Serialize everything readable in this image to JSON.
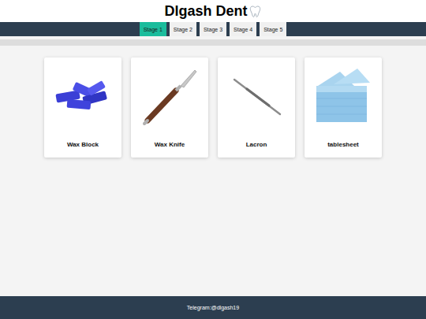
{
  "header": {
    "title": "Dlgash Dent"
  },
  "tabs": [
    {
      "label": "Stage 1",
      "selected": true
    },
    {
      "label": "Stage 2",
      "selected": false
    },
    {
      "label": "Stage 3",
      "selected": false
    },
    {
      "label": "Stage 4",
      "selected": false
    },
    {
      "label": "Stage 5",
      "selected": false
    }
  ],
  "items": [
    {
      "name": "Wax Block",
      "kind": "block"
    },
    {
      "name": "Wax Knife",
      "kind": "knife"
    },
    {
      "name": "Lacron",
      "kind": "probe"
    },
    {
      "name": "tablesheet",
      "kind": "sheets"
    }
  ],
  "footer": {
    "text": "Telegram:@dlgash19"
  }
}
